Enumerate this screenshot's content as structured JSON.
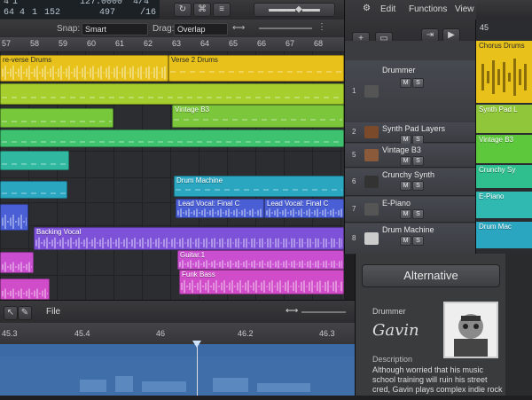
{
  "lcd": {
    "row1_a": "4",
    "row1_b": "1",
    "row1_c": "127.0000",
    "row1_d": "4/4",
    "row2_a": "64",
    "row2_b": "4",
    "row2_c": "1",
    "row2_d": "152",
    "row2_e": "497",
    "row2_f": "/16"
  },
  "arrange_toolbar": {
    "snap_label": "Snap:",
    "snap_value": "Smart",
    "drag_label": "Drag:",
    "drag_value": "Overlap"
  },
  "ruler": [
    "57",
    "58",
    "59",
    "60",
    "61",
    "62",
    "63",
    "64",
    "65",
    "66",
    "67",
    "68"
  ],
  "regions": [
    {
      "name": "re-verse Drums",
      "color": "#e8c21a",
      "dark": true
    },
    {
      "name": "Verse 2 Drums",
      "color": "#e8c21a",
      "dark": true
    },
    {
      "name": "Vintage B3",
      "color": "#7cc63c",
      "dark": false
    },
    {
      "name": "Drum Machine",
      "color": "#2aa6c0",
      "dark": false
    },
    {
      "name": "Lead Vocal: Final C",
      "color": "#4a5fd6",
      "dark": false
    },
    {
      "name": "Lead Vocal: Final C",
      "color": "#4a5fd6",
      "dark": false
    },
    {
      "name": "Backing Vocal",
      "color": "#7d52d8",
      "dark": false
    },
    {
      "name": "Guitar.1",
      "color": "#c94fd0",
      "dark": false
    },
    {
      "name": "Funk Bass",
      "color": "#d04cc8",
      "dark": false
    }
  ],
  "library_menu": {
    "edit": "Edit",
    "functions": "Functions",
    "view": "View"
  },
  "tracks": [
    {
      "num": "1",
      "name": "Drummer",
      "mute": "M",
      "solo": "S"
    },
    {
      "num": "2",
      "name": "Synth Pad Layers",
      "mute": "M",
      "solo": "S"
    },
    {
      "num": "5",
      "name": "Vintage B3",
      "mute": "M",
      "solo": "S"
    },
    {
      "num": "6",
      "name": "Crunchy Synth",
      "mute": "M",
      "solo": "S"
    },
    {
      "num": "7",
      "name": "E-Piano",
      "mute": "M",
      "solo": "S"
    },
    {
      "num": "8",
      "name": "Drum Machine",
      "mute": "M",
      "solo": "S"
    }
  ],
  "right_strip": {
    "num": "45",
    "r1": "Chorus Drums",
    "r2": "Synth Pad L",
    "r3": "Vintage B3",
    "r4": "Crunchy Sy",
    "r5": "E-Piano",
    "r6": "Drum Mac"
  },
  "editor": {
    "file_label": "File",
    "ruler": [
      "45.3",
      "45.4",
      "46",
      "46.2",
      "46.3"
    ]
  },
  "info_panel": {
    "alt_button": "Alternative",
    "drummer_label": "Drummer",
    "drummer_name": "Gavin",
    "description_label": "Description",
    "description_text_1": "Although worried that his music",
    "description_text_2": "school training will ruin his street",
    "description_text_3": "cred, Gavin plays complex indie rock"
  },
  "colors": {
    "drums": "#e8c21a",
    "keys": "#7cc63c",
    "synth": "#2aa6c0",
    "vocal": "#4a5fd6",
    "backing": "#7d52d8",
    "guitar": "#c94fd0"
  }
}
